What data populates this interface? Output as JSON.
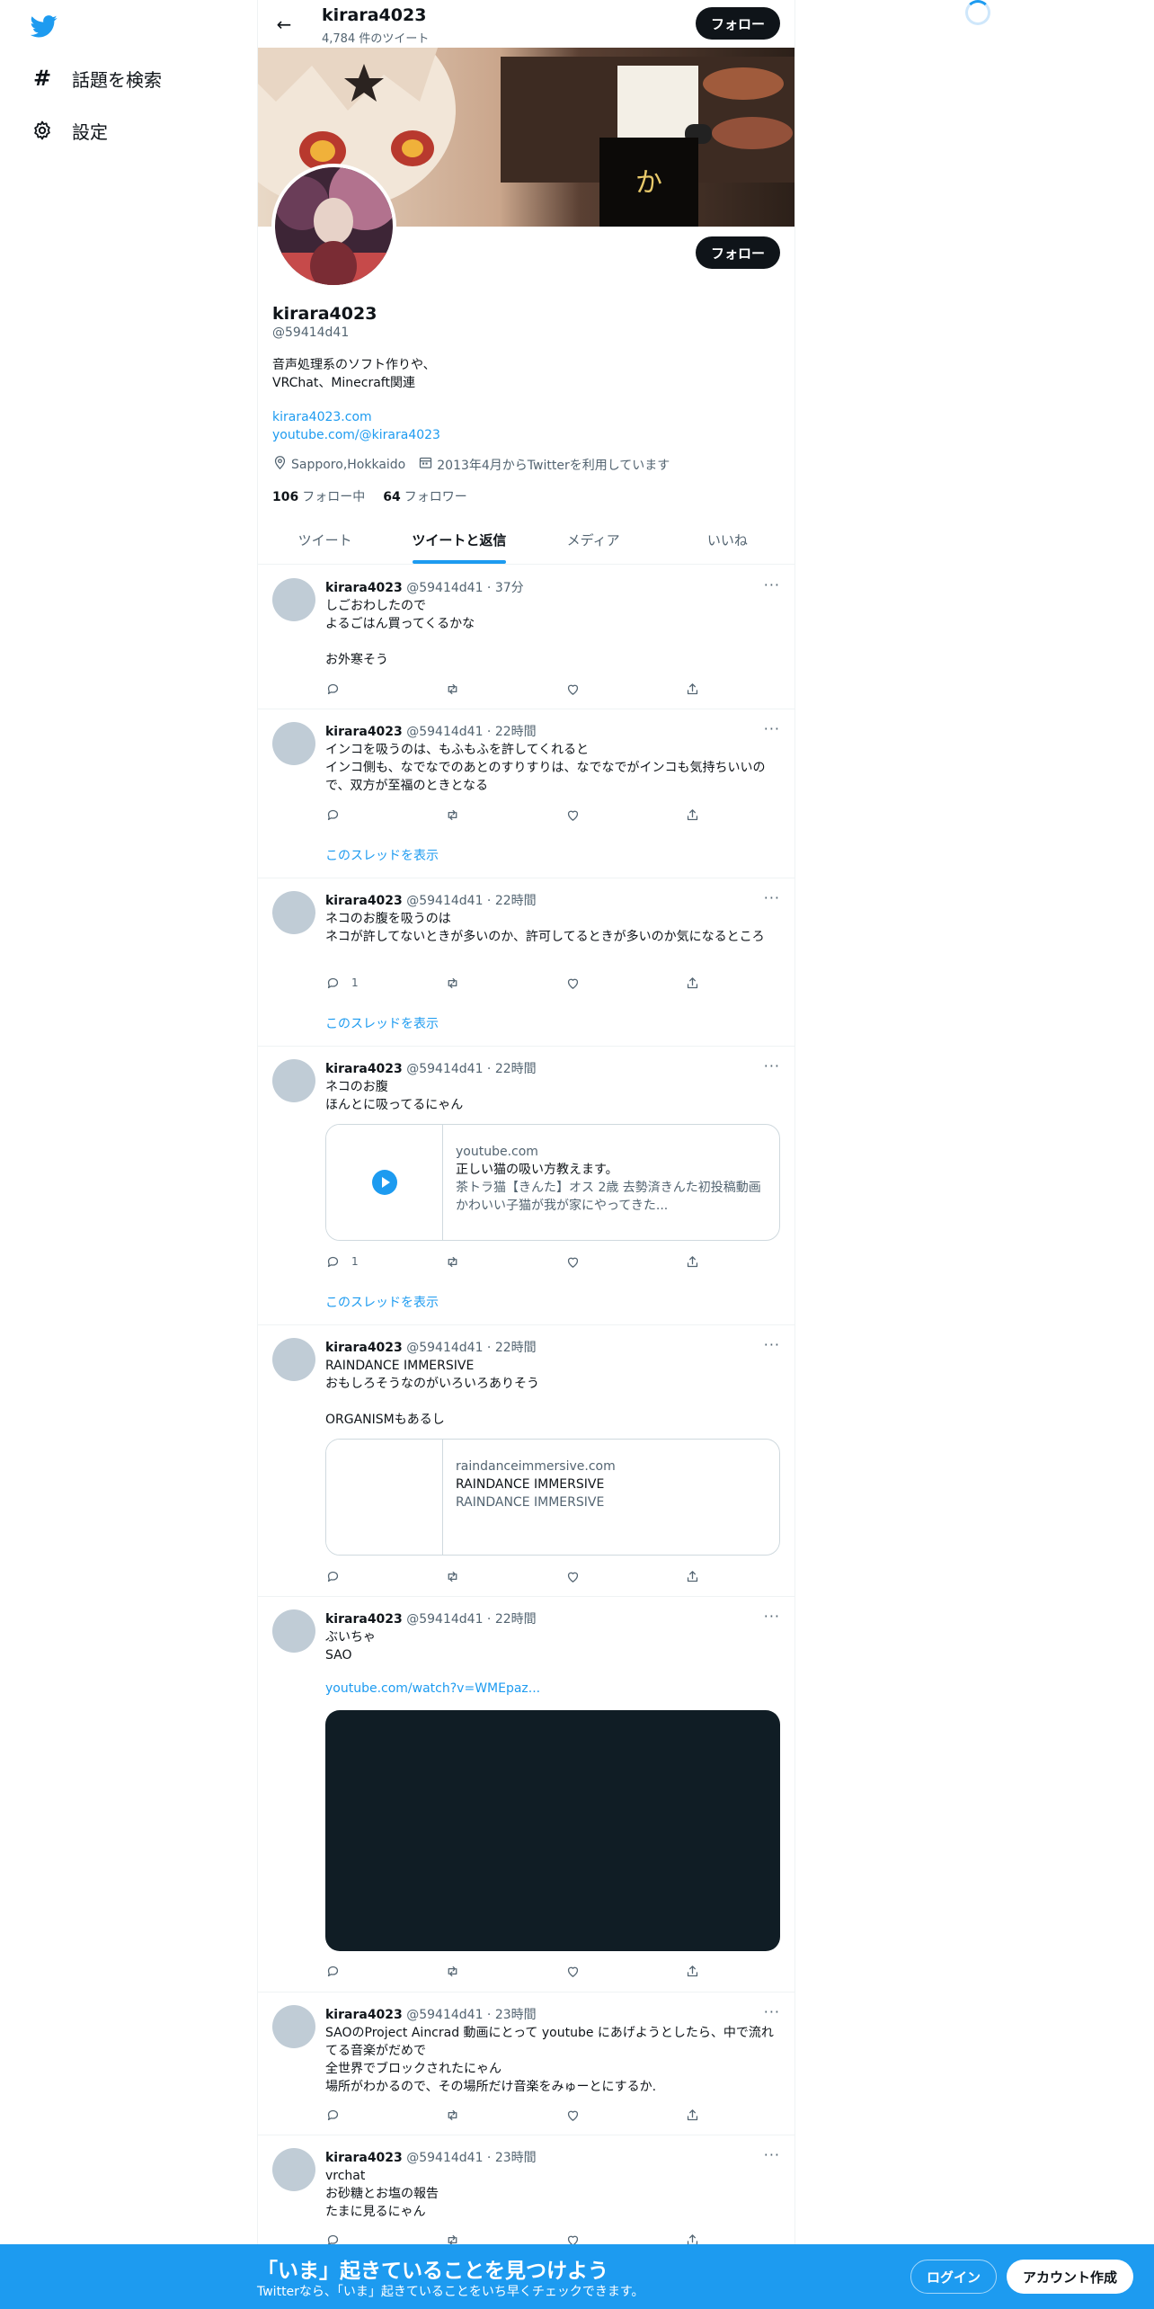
{
  "nav": {
    "logo_icon": "twitter-bird-icon",
    "explore_label": "話題を検索",
    "settings_label": "設定"
  },
  "header": {
    "display_name": "kirara4023",
    "tweet_count": "4,784 件のツイート",
    "follow_label": "フォロー"
  },
  "profile": {
    "display_name": "kirara4023",
    "handle": "@59414d41",
    "bio_line1": "音声処理系のソフト作りや、",
    "bio_line2": "VRChat、Minecraft関連",
    "link1": "kirara4023.com",
    "link2": "youtube.com/@kirara4023",
    "location": "Sapporo,Hokkaido",
    "joined": "2013年4月からTwitterを利用しています",
    "following_count": "106",
    "following_label": "フォロー中",
    "followers_count": "64",
    "followers_label": "フォロワー",
    "follow_label": "フォロー"
  },
  "tabs": [
    {
      "label": "ツイート",
      "active": false
    },
    {
      "label": "ツイートと返信",
      "active": true
    },
    {
      "label": "メディア",
      "active": false
    },
    {
      "label": "いいね",
      "active": false
    }
  ],
  "thread_label": "このスレッドを表示",
  "more_label": "···",
  "tweets": [
    {
      "name": "kirara4023",
      "meta": "@59414d41 · 37分",
      "text": "しごおわしたので\nよるごはん買ってくるかな\n\nお外寒そう",
      "reply_count": ""
    },
    {
      "name": "kirara4023",
      "meta": "@59414d41 · 22時間",
      "text": "インコを吸うのは、もふもふを許してくれると\nインコ側も、なでなでのあとのすりすりは、なでなでがインコも気持ちいいので、双方が至福のときとなる",
      "reply_count": ""
    },
    {
      "name": "kirara4023",
      "meta": "@59414d41 · 22時間",
      "text": "ネコのお腹を吸うのは\nネコが許してないときが多いのか、許可してるときが多いのか気になるところ",
      "reply_count": "1"
    },
    {
      "name": "kirara4023",
      "meta": "@59414d41 · 22時間",
      "text": "ネコのお腹\nほんとに吸ってるにゃん",
      "reply_count": "1",
      "card": {
        "domain": "youtube.com",
        "title": "正しい猫の吸い方教えます。",
        "desc": "茶トラ猫【きんた】オス 2歳 去勢済きんた初投稿動画かわいい子猫が我が家にやってきた..."
      }
    },
    {
      "name": "kirara4023",
      "meta": "@59414d41 · 22時間",
      "text": "RAINDANCE IMMERSIVE\nおもしろそうなのがいろいろありそう\n\nORGANISMもあるし",
      "reply_count": "",
      "card": {
        "domain": "raindanceimmersive.com",
        "title": "RAINDANCE IMMERSIVE",
        "desc": "RAINDANCE IMMERSIVE"
      }
    },
    {
      "name": "kirara4023",
      "meta": "@59414d41 · 22時間",
      "text": "ぶいちゃ\nSAO",
      "link": "youtube.com/watch?v=WMEpaz...",
      "reply_count": ""
    },
    {
      "name": "kirara4023",
      "meta": "@59414d41 · 23時間",
      "text": "SAOのProject Aincrad 動画にとって youtube にあげようとしたら、中で流れてる音楽がだめで\n全世界でブロックされたにゃん\n場所がわかるので、その場所だけ音楽をみゅーとにするか.",
      "reply_count": ""
    },
    {
      "name": "kirara4023",
      "meta": "@59414d41 · 23時間",
      "text": "vrchat\nお砂糖とお塩の報告\nたまに見るにゃん",
      "reply_count": ""
    }
  ],
  "bottom": {
    "title": "「いま」起きていることを見つけよう",
    "subtitle": "Twitterなら、「いま」起きていることをいち早くチェックできます。",
    "login_label": "ログイン",
    "signup_label": "アカウント作成"
  },
  "colors": {
    "accent": "#1d9bf0",
    "text": "#0f1419",
    "muted": "#536471"
  }
}
